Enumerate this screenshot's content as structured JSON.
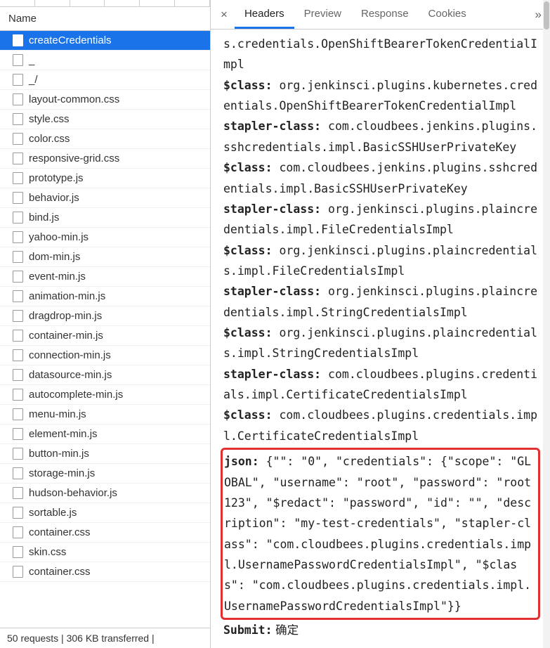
{
  "header": {
    "name_label": "Name"
  },
  "files": [
    {
      "name": "createCredentials",
      "selected": true
    },
    {
      "name": "_"
    },
    {
      "name": "_/"
    },
    {
      "name": "layout-common.css"
    },
    {
      "name": "style.css"
    },
    {
      "name": "color.css"
    },
    {
      "name": "responsive-grid.css"
    },
    {
      "name": "prototype.js"
    },
    {
      "name": "behavior.js"
    },
    {
      "name": "bind.js"
    },
    {
      "name": "yahoo-min.js"
    },
    {
      "name": "dom-min.js"
    },
    {
      "name": "event-min.js"
    },
    {
      "name": "animation-min.js"
    },
    {
      "name": "dragdrop-min.js"
    },
    {
      "name": "container-min.js"
    },
    {
      "name": "connection-min.js"
    },
    {
      "name": "datasource-min.js"
    },
    {
      "name": "autocomplete-min.js"
    },
    {
      "name": "menu-min.js"
    },
    {
      "name": "element-min.js"
    },
    {
      "name": "button-min.js"
    },
    {
      "name": "storage-min.js"
    },
    {
      "name": "hudson-behavior.js"
    },
    {
      "name": "sortable.js"
    },
    {
      "name": "container.css"
    },
    {
      "name": "skin.css"
    },
    {
      "name": "container.css"
    }
  ],
  "status": "50 requests | 306 KB transferred | ",
  "tabs": {
    "close": "×",
    "headers": "Headers",
    "preview": "Preview",
    "response": "Response",
    "cookies": "Cookies",
    "overflow": "»"
  },
  "payload": {
    "line0": "s.credentials.OpenShiftBearerTokenCredentialImpl",
    "items": [
      {
        "k": "$class:",
        "v": " org.jenkinsci.plugins.kubernetes.credentials.OpenShiftBearerTokenCredentialImpl"
      },
      {
        "k": "stapler-class:",
        "v": " com.cloudbees.jenkins.plugins.sshcredentials.impl.BasicSSHUserPrivateKey"
      },
      {
        "k": "$class:",
        "v": " com.cloudbees.jenkins.plugins.sshcredentials.impl.BasicSSHUserPrivateKey"
      },
      {
        "k": "stapler-class:",
        "v": " org.jenkinsci.plugins.plaincredentials.impl.FileCredentialsImpl"
      },
      {
        "k": "$class:",
        "v": " org.jenkinsci.plugins.plaincredentials.impl.FileCredentialsImpl"
      },
      {
        "k": "stapler-class:",
        "v": " org.jenkinsci.plugins.plaincredentials.impl.StringCredentialsImpl"
      },
      {
        "k": "$class:",
        "v": " org.jenkinsci.plugins.plaincredentials.impl.StringCredentialsImpl"
      },
      {
        "k": "stapler-class:",
        "v": " com.cloudbees.plugins.credentials.impl.CertificateCredentialsImpl"
      },
      {
        "k": "$class:",
        "v": " com.cloudbees.plugins.credentials.impl.CertificateCredentialsImpl"
      }
    ],
    "json_key": "json:",
    "json_value": " {\"\": \"0\", \"credentials\": {\"scope\": \"GLOBAL\", \"username\": \"root\", \"password\": \"root123\", \"$redact\": \"password\", \"id\": \"\", \"description\": \"my-test-credentials\", \"stapler-class\": \"com.cloudbees.plugins.credentials.impl.UsernamePasswordCredentialsImpl\", \"$class\": \"com.cloudbees.plugins.credentials.impl.UsernamePasswordCredentialsImpl\"}}",
    "submit_key": "Submit:",
    "submit_value": " 确定"
  }
}
